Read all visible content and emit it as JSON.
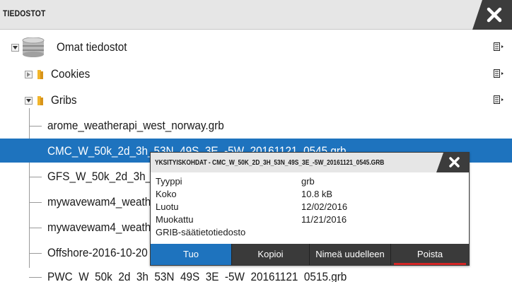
{
  "window": {
    "title": "TIEDOSTOT",
    "close_icon": "close-icon"
  },
  "tree": {
    "root": {
      "label": "Omat tiedostot",
      "icon": "database-icon",
      "expanded": true
    },
    "folders": [
      {
        "label": "Cookies",
        "icon": "folder-icon",
        "expanded": false
      },
      {
        "label": "Gribs",
        "icon": "folder-icon",
        "expanded": true
      }
    ],
    "files": [
      {
        "label": "arome_weatherapi_west_norway.grb"
      },
      {
        "label": "CMC_W_50k_2d_3h_53N_49S_3E_-5W_20161121_0545.grb"
      },
      {
        "label": "GFS_W_50k_2d_3h_53"
      },
      {
        "label": "mywavewam4_weath"
      },
      {
        "label": "mywavewam4_weath"
      },
      {
        "label": "Offshore-2016-10-20"
      },
      {
        "label": "PWC_W_50k_2d_3h_53N_49S_3E_-5W_20161121_0515.grb"
      }
    ],
    "selected_index": 1
  },
  "popup": {
    "title": "YKSITYISKOHDAT - CMC_W_50K_2D_3H_53N_49S_3E_-5W_20161121_0545.GRB",
    "properties": [
      {
        "name": "Tyyppi",
        "value": "grb"
      },
      {
        "name": "Koko",
        "value": "10.8 kB"
      },
      {
        "name": "Luotu",
        "value": "12/02/2016"
      },
      {
        "name": "Muokattu",
        "value": "11/21/2016"
      },
      {
        "name": "GRIB-säätietotiedosto",
        "value": ""
      }
    ],
    "buttons": {
      "import": "Tuo",
      "copy": "Kopioi",
      "rename": "Nimeä uudelleen",
      "delete": "Poista"
    }
  },
  "colors": {
    "selection": "#1e73be",
    "delete_underline": "#d42626"
  }
}
